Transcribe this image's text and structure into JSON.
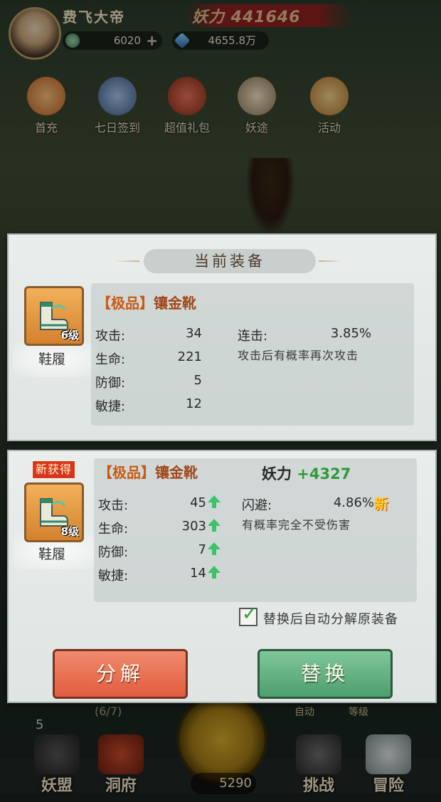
{
  "player": {
    "name": "费飞大帝",
    "power_label": "妖力 441646"
  },
  "resources": [
    {
      "icon": "jade-coin-icon",
      "value": "6020"
    },
    {
      "icon": "crystal-icon",
      "value": "4655.8万"
    }
  ],
  "features": [
    {
      "icon": "first-recharge-icon",
      "label": "首充"
    },
    {
      "icon": "seven-day-signin-icon",
      "label": "七日签到"
    },
    {
      "icon": "value-gift-bag-icon",
      "label": "超值礼包"
    },
    {
      "icon": "yao-path-book-icon",
      "label": "妖途"
    },
    {
      "icon": "event-scroll-icon",
      "label": "活动"
    }
  ],
  "current": {
    "title": "当前装备",
    "quality": "【极品】",
    "name": "镶金靴",
    "level": "6级",
    "slot": "鞋履",
    "stats": [
      {
        "label": "攻击:",
        "value": "34"
      },
      {
        "label": "生命:",
        "value": "221"
      },
      {
        "label": "防御:",
        "value": "5"
      },
      {
        "label": "敏捷:",
        "value": "12"
      }
    ],
    "special": {
      "label": "连击:",
      "value": "3.85%",
      "desc": "攻击后有概率再次攻击"
    }
  },
  "new_item": {
    "tag": "新获得",
    "quality": "【极品】",
    "name": "镶金靴",
    "level": "8级",
    "slot": "鞋履",
    "power_label": "妖力",
    "power_delta": "+4327",
    "stats": [
      {
        "label": "攻击:",
        "value": "45"
      },
      {
        "label": "生命:",
        "value": "303"
      },
      {
        "label": "防御:",
        "value": "7"
      },
      {
        "label": "敏捷:",
        "value": "14"
      }
    ],
    "special": {
      "label": "闪避:",
      "value": "4.86%",
      "new_glyph": "新",
      "desc": "有概率完全不受伤害"
    },
    "auto_decompose": {
      "checked": true,
      "label": "替换后自动分解原装备"
    }
  },
  "buttons": {
    "decompose": "分解",
    "replace": "替换"
  },
  "bottom": {
    "progress": "(6/7)",
    "count": "5",
    "coin": "5290",
    "mini_labels": [
      "自动",
      "等级"
    ],
    "nav": [
      {
        "icon": "yao-alliance-icon",
        "label": "妖盟"
      },
      {
        "icon": "cave-mansion-icon",
        "label": "洞府"
      },
      {
        "icon": "challenge-icon",
        "label": "挑战"
      },
      {
        "icon": "adventure-icon",
        "label": "冒险"
      }
    ]
  }
}
